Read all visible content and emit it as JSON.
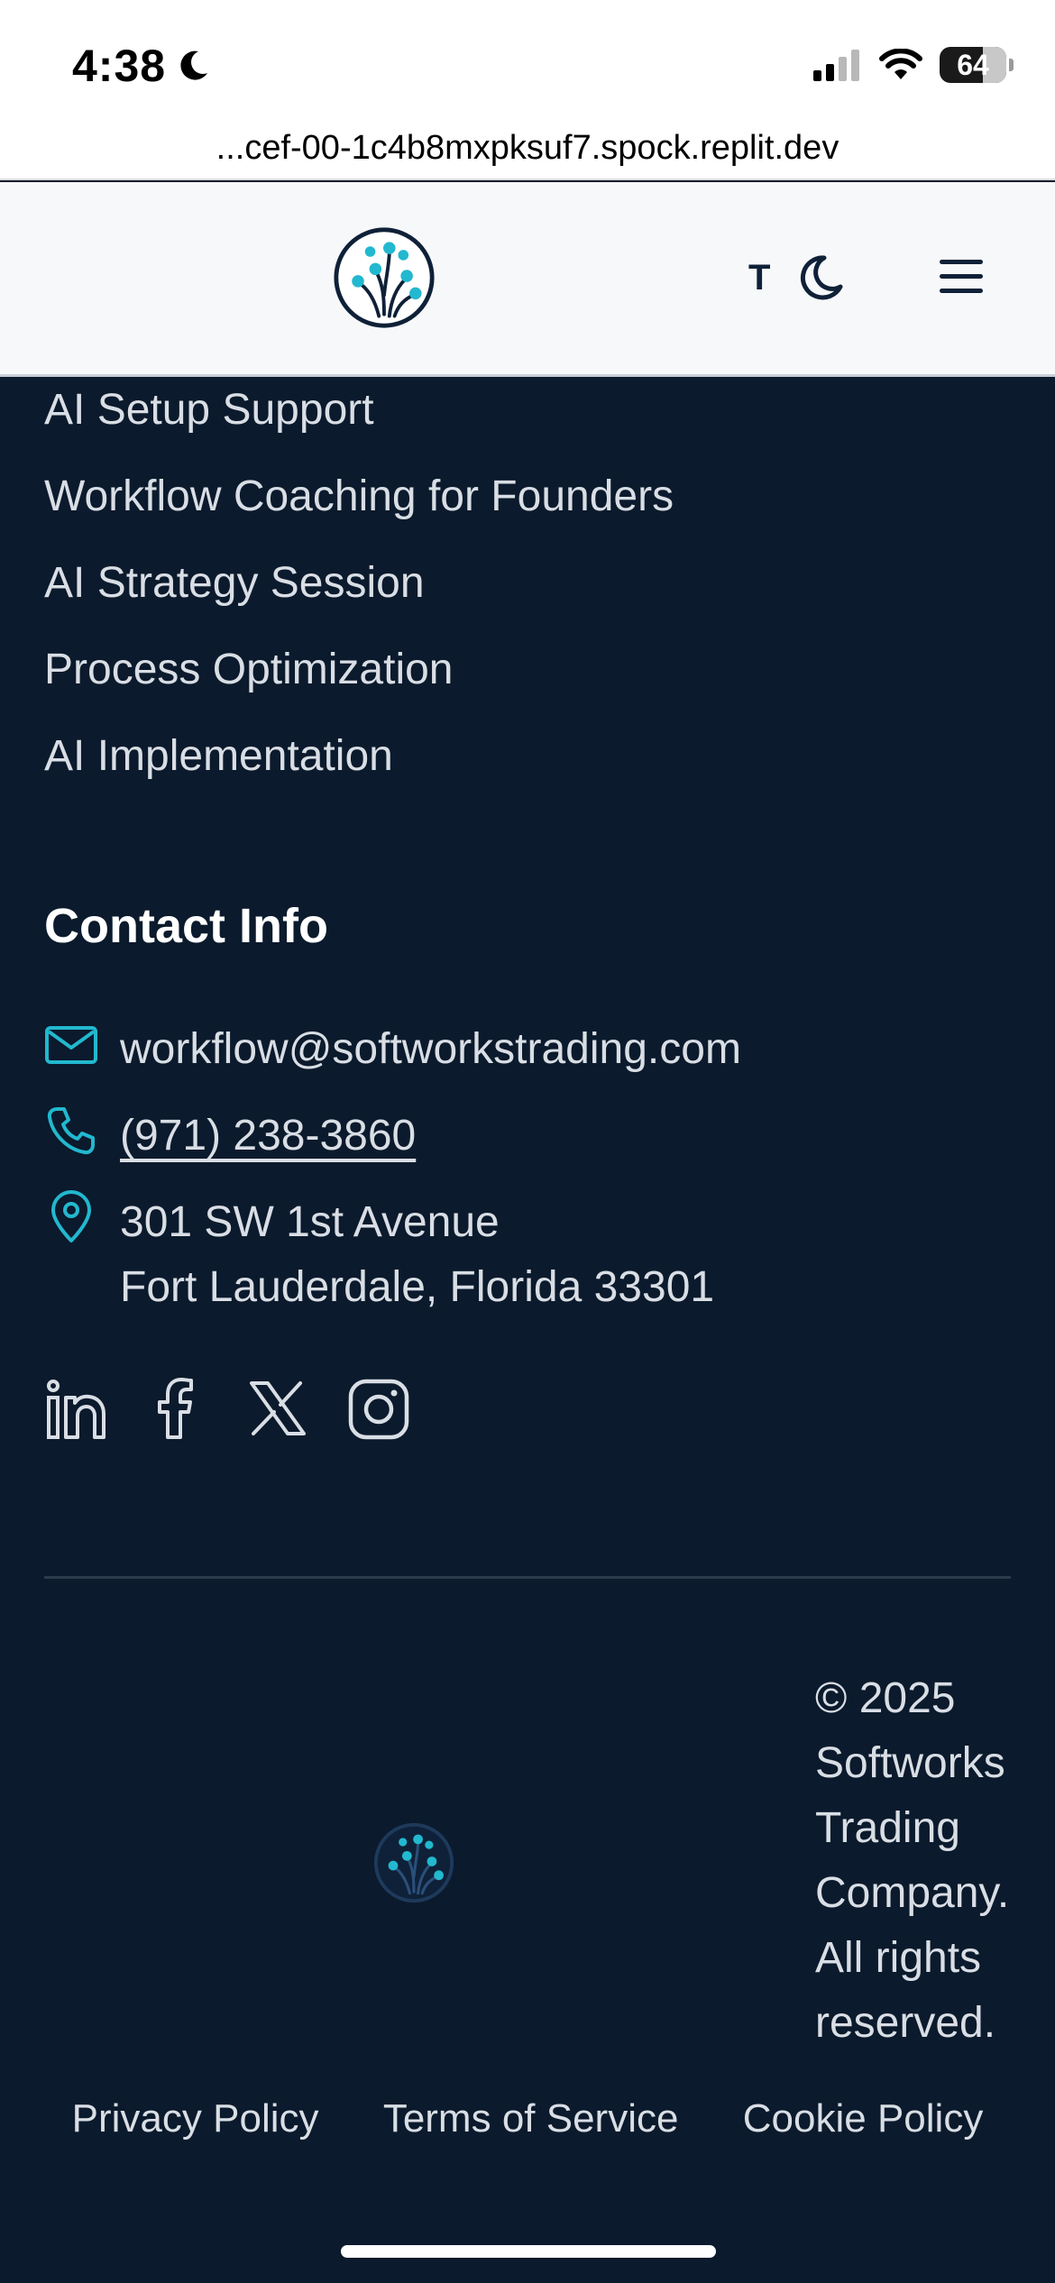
{
  "status_bar": {
    "time": "4:38",
    "battery": "64",
    "icons": [
      "moon-icon",
      "signal-icon",
      "wifi-icon",
      "battery-icon"
    ]
  },
  "browser": {
    "url": "...cef-00-1c4b8mxpksuf7.spock.replit.dev"
  },
  "header": {
    "text_size_label": "T",
    "icons": [
      "brand-logo-icon",
      "moon-icon",
      "menu-icon"
    ]
  },
  "services": [
    "AI Setup Support",
    "Workflow Coaching for Founders",
    "AI Strategy Session",
    "Process Optimization",
    "AI Implementation"
  ],
  "contact": {
    "title": "Contact Info",
    "email": "workflow@softworkstrading.com",
    "phone": "(971) 238-3860",
    "address_line1": "301 SW 1st Avenue",
    "address_line2": "Fort Lauderdale, Florida 33301"
  },
  "socials": [
    "linkedin-icon",
    "facebook-icon",
    "x-icon",
    "instagram-icon"
  ],
  "copyright": {
    "line1": "© 2025",
    "line2": "Softworks",
    "line3": "Trading",
    "line4": "Company.",
    "line5": "All rights",
    "line6": "reserved."
  },
  "legal": {
    "privacy": "Privacy Policy",
    "terms": "Terms of Service",
    "cookie": "Cookie Policy"
  },
  "colors": {
    "background": "#0b1a2c",
    "accent": "#22b8cf",
    "text": "#d9dee5",
    "header_bg": "#f7f8fa",
    "logo_navy": "#0f2138"
  }
}
